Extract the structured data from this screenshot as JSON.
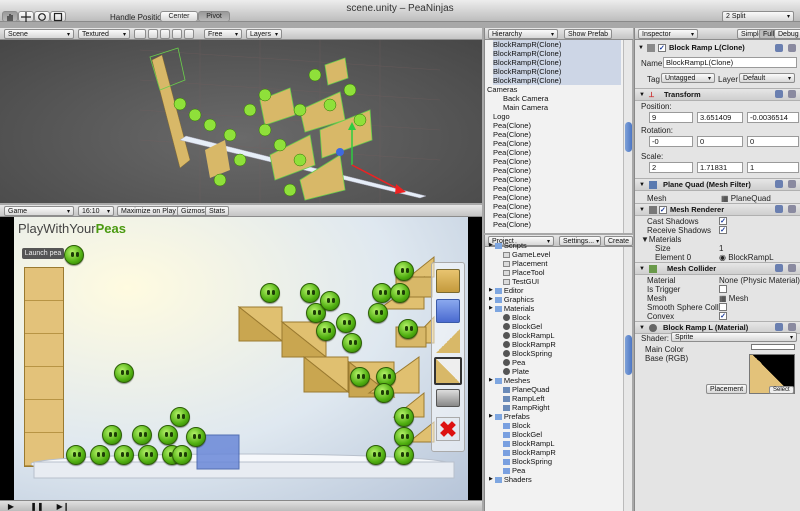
{
  "window": {
    "title": "scene.unity – PeaNinjas"
  },
  "toolbar": {
    "tools": [
      "hand-icon",
      "move-icon",
      "rotate-icon",
      "scale-icon"
    ],
    "handle_label": "Handle Position:",
    "center": "Center",
    "pivot": "Pivot",
    "layout": "2 Split"
  },
  "scene": {
    "tab": "Scene",
    "shading": "Textured",
    "mode": "Free",
    "layers": "Layers"
  },
  "game": {
    "tab": "Game",
    "aspect": "16:10",
    "maximize": "Maximize on Play",
    "gizmos": "Gizmos",
    "stats": "Stats",
    "logo_prefix": "PlayWithYour",
    "logo_suffix": "Peas",
    "launch": "Launch pea"
  },
  "hierarchy": {
    "tab": "Hierarchy",
    "show_prefab": "Show Prefab",
    "items": [
      "BlockRampR(Clone)",
      "BlockRampR(Clone)",
      "BlockRampR(Clone)",
      "BlockRampR(Clone)",
      "BlockRampR(Clone)",
      "Cameras",
      "Back Camera",
      "Main Camera",
      "Logo",
      "Pea(Clone)",
      "Pea(Clone)",
      "Pea(Clone)",
      "Pea(Clone)",
      "Pea(Clone)",
      "Pea(Clone)",
      "Pea(Clone)",
      "Pea(Clone)",
      "Pea(Clone)",
      "Pea(Clone)",
      "Pea(Clone)",
      "Pea(Clone)"
    ]
  },
  "project": {
    "tab": "Project",
    "settings": "Settings...",
    "create": "Create",
    "items": [
      {
        "label": "Scripts",
        "kind": "folder",
        "indent": 1
      },
      {
        "label": "GameLevel",
        "kind": "script",
        "indent": 2
      },
      {
        "label": "Placement",
        "kind": "script",
        "indent": 2
      },
      {
        "label": "PlaceTool",
        "kind": "script",
        "indent": 2
      },
      {
        "label": "TestGUI",
        "kind": "script",
        "indent": 2
      },
      {
        "label": "Editor",
        "kind": "folder",
        "indent": 1
      },
      {
        "label": "Graphics",
        "kind": "folder",
        "indent": 1
      },
      {
        "label": "Materials",
        "kind": "folder",
        "indent": 1
      },
      {
        "label": "Block",
        "kind": "material",
        "indent": 2
      },
      {
        "label": "BlockGel",
        "kind": "material",
        "indent": 2
      },
      {
        "label": "BlockRampL",
        "kind": "material",
        "indent": 2
      },
      {
        "label": "BlockRampR",
        "kind": "material",
        "indent": 2
      },
      {
        "label": "BlockSpring",
        "kind": "material",
        "indent": 2
      },
      {
        "label": "Pea",
        "kind": "material",
        "indent": 2
      },
      {
        "label": "Plate",
        "kind": "material",
        "indent": 2
      },
      {
        "label": "Meshes",
        "kind": "folder",
        "indent": 1
      },
      {
        "label": "PlaneQuad",
        "kind": "mesh",
        "indent": 2
      },
      {
        "label": "RampLeft",
        "kind": "mesh",
        "indent": 2
      },
      {
        "label": "RampRight",
        "kind": "mesh",
        "indent": 2
      },
      {
        "label": "Prefabs",
        "kind": "folder",
        "indent": 1
      },
      {
        "label": "Block",
        "kind": "prefab",
        "indent": 2
      },
      {
        "label": "BlockGel",
        "kind": "prefab",
        "indent": 2
      },
      {
        "label": "BlockRampL",
        "kind": "prefab",
        "indent": 2
      },
      {
        "label": "BlockRampR",
        "kind": "prefab",
        "indent": 2
      },
      {
        "label": "BlockSpring",
        "kind": "prefab",
        "indent": 2
      },
      {
        "label": "Pea",
        "kind": "prefab",
        "indent": 2
      },
      {
        "label": "Shaders",
        "kind": "folder",
        "indent": 1
      }
    ]
  },
  "inspector": {
    "tab": "Inspector",
    "simple": "Simple",
    "full": "Full",
    "debug": "Debug",
    "object_name": "Block Ramp L(Clone)",
    "name_label": "Name:",
    "name_value": "BlockRampL(Clone)",
    "tag_label": "Tag",
    "tag_value": "Untagged",
    "layer_label": "Layer",
    "layer_value": "Default",
    "transform": "Transform",
    "position_label": "Position:",
    "position": [
      "9",
      "3.651409",
      "-0.0036514"
    ],
    "rotation_label": "Rotation:",
    "rotation": [
      "-0",
      "0",
      "0"
    ],
    "scale_label": "Scale:",
    "scale": [
      "2",
      "1.71831",
      "1"
    ],
    "meshfilter": "Plane Quad (Mesh Filter)",
    "mesh_label": "Mesh",
    "mesh_value": "PlaneQuad",
    "renderer": "Mesh Renderer",
    "cast": "Cast Shadows",
    "receive": "Receive Shadows",
    "materials": "Materials",
    "size_label": "Size",
    "size_value": "1",
    "element_label": "Element 0",
    "element_value": "BlockRampL",
    "collider": "Mesh Collider",
    "col_material": "Material",
    "col_material_value": "None (Physic Material)",
    "trigger": "Is Trigger",
    "col_mesh": "Mesh",
    "col_mesh_value": "Mesh",
    "smooth": "Smooth Sphere Collisi",
    "convex": "Convex",
    "mat_title": "Block Ramp L (Material)",
    "shader_label": "Shader:",
    "shader_value": "Sprite",
    "main_color": "Main Color",
    "base": "Base (RGB)",
    "select": "Select",
    "placement": "Placement"
  },
  "colors": {
    "pea": "#5fbf16",
    "ramp": "#d9b86a",
    "panel": "#dcdcdc",
    "selection": "#b4c6e8"
  }
}
